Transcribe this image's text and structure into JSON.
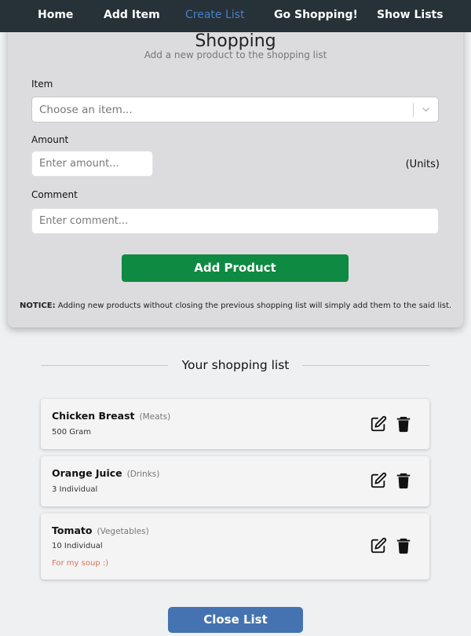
{
  "nav": {
    "home": "Home",
    "add_item": "Add Item",
    "create_list": "Create List",
    "go_shopping": "Go Shopping!",
    "show_lists": "Show Lists"
  },
  "form": {
    "heading": "Shopping",
    "subtitle": "Add a new product to the shopping list",
    "item_label": "Item",
    "item_placeholder": "Choose an item...",
    "amount_label": "Amount",
    "amount_placeholder": "Enter amount...",
    "units": "(Units)",
    "comment_label": "Comment",
    "comment_placeholder": "Enter comment...",
    "add_button": "Add Product",
    "notice_label": "NOTICE:",
    "notice_text": "Adding new products without closing the previous shopping list will simply add them to the said list."
  },
  "shopping_list": {
    "title": "Your shopping list",
    "items": [
      {
        "name": "Chicken Breast",
        "category": "(Meats)",
        "quantity": "500 Gram",
        "comment": ""
      },
      {
        "name": "Orange Juice",
        "category": "(Drinks)",
        "quantity": "3 Individual",
        "comment": ""
      },
      {
        "name": "Tomato",
        "category": "(Vegetables)",
        "quantity": "10 Individual",
        "comment": "For my soup :)"
      }
    ],
    "close_button": "Close List"
  },
  "colors": {
    "navbar": "#263138",
    "nav_active": "#4a7fc5",
    "add_button": "#0e8a42",
    "close_button": "#4573b1",
    "comment": "#d9735d"
  },
  "icons": {
    "edit": "edit-icon",
    "delete": "trash-icon",
    "dropdown": "chevron-down-icon"
  }
}
